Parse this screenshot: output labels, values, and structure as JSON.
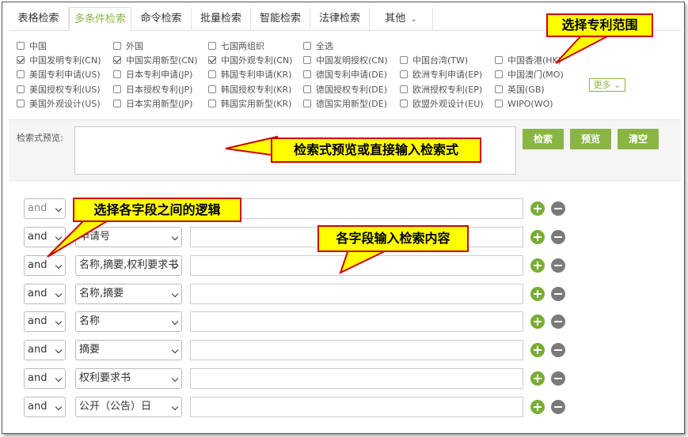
{
  "tabs": [
    {
      "label": "表格检索",
      "active": false
    },
    {
      "label": "多条件检索",
      "active": true
    },
    {
      "label": "命令检索",
      "active": false
    },
    {
      "label": "批量检索",
      "active": false
    },
    {
      "label": "智能检索",
      "active": false
    },
    {
      "label": "法律检索",
      "active": false
    },
    {
      "label": "其他",
      "active": false
    }
  ],
  "countries": [
    {
      "label": "中国",
      "checked": false
    },
    {
      "label": "外国",
      "checked": false
    },
    {
      "label": "七国两组织",
      "checked": false
    },
    {
      "label": "全选",
      "checked": false
    },
    {
      "label": "中国发明专利(CN)",
      "checked": true
    },
    {
      "label": "中国实用新型(CN)",
      "checked": true
    },
    {
      "label": "中国外观专利(CN)",
      "checked": true
    },
    {
      "label": "中国发明授权(CN)",
      "checked": false
    },
    {
      "label": "中国台湾(TW)",
      "checked": false
    },
    {
      "label": "中国香港(HK)",
      "checked": false
    },
    {
      "label": "美国专利申请(US)",
      "checked": false
    },
    {
      "label": "日本专利申请(JP)",
      "checked": false
    },
    {
      "label": "韩国专利申请(KR)",
      "checked": false
    },
    {
      "label": "德国专利申请(DE)",
      "checked": false
    },
    {
      "label": "欧洲专利申请(EP)",
      "checked": false
    },
    {
      "label": "中国澳门(MO)",
      "checked": false
    },
    {
      "label": "美国授权专利(US)",
      "checked": false
    },
    {
      "label": "日本授权专利(JP)",
      "checked": false
    },
    {
      "label": "韩国授权专利(KR)",
      "checked": false
    },
    {
      "label": "德国授权专利(DE)",
      "checked": false
    },
    {
      "label": "欧洲授权专利(EP)",
      "checked": false
    },
    {
      "label": "英国(GB)",
      "checked": false
    },
    {
      "label": "美国外观设计(US)",
      "checked": false
    },
    {
      "label": "日本实用新型(JP)",
      "checked": false
    },
    {
      "label": "韩国实用新型(KR)",
      "checked": false
    },
    {
      "label": "德国实用新型(DE)",
      "checked": false
    },
    {
      "label": "欧盟外观设计(EU)",
      "checked": false
    },
    {
      "label": "WIPO(WO)",
      "checked": false
    }
  ],
  "more_label": "更多",
  "preview": {
    "label": "检索式预览:",
    "value": "",
    "search_label": "检索",
    "preview_label": "预览",
    "clear_label": "清空"
  },
  "rows": [
    {
      "logic": "and",
      "field": ""
    },
    {
      "logic": "and",
      "field": "申请号"
    },
    {
      "logic": "and",
      "field": "名称,摘要,权利要求书"
    },
    {
      "logic": "and",
      "field": "名称,摘要"
    },
    {
      "logic": "and",
      "field": "名称"
    },
    {
      "logic": "and",
      "field": "摘要"
    },
    {
      "logic": "and",
      "field": "权利要求书"
    },
    {
      "logic": "and",
      "field": "公开（公告）日"
    }
  ],
  "callouts": {
    "patent_scope": "选择专利范围",
    "preview_hint": "检索式预览或直接输入检索式",
    "logic_hint": "选择各字段之间的逻辑",
    "field_hint": "各字段输入检索内容"
  },
  "colors": {
    "accent_green": "#8ab544",
    "callout_fill": "#ffff00",
    "callout_border": "#d00000"
  }
}
